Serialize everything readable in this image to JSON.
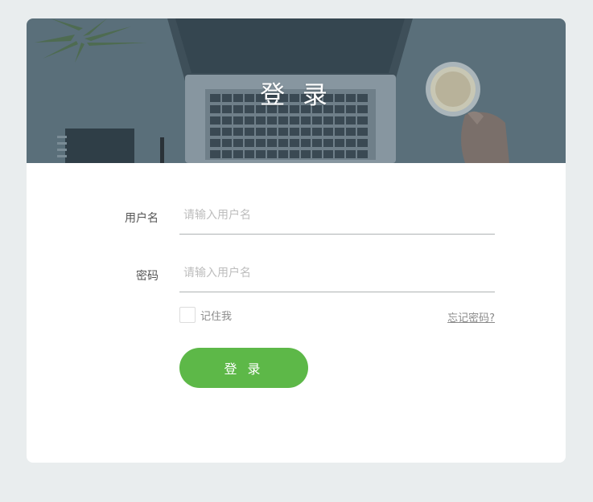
{
  "banner": {
    "title": "登 录"
  },
  "form": {
    "username": {
      "label": "用户名",
      "placeholder": "请输入用户名"
    },
    "password": {
      "label": "密码",
      "placeholder": "请输入用户名"
    },
    "remember_label": "记住我",
    "forgot_link": "忘记密码?",
    "submit_label": "登 录"
  },
  "colors": {
    "page_bg": "#e9edee",
    "banner_tint": "#5a6f7a",
    "primary_button": "#5db848"
  },
  "icons": {
    "remember": "checkbox-unchecked"
  }
}
